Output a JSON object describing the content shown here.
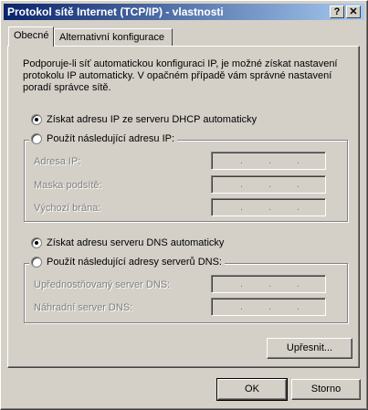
{
  "window": {
    "title": "Protokol sítě Internet (TCP/IP) - vlastnosti",
    "help_glyph": "?",
    "close_glyph": "✕"
  },
  "tabs": [
    {
      "label": "Obecné",
      "active": true
    },
    {
      "label": "Alternativní konfigurace",
      "active": false
    }
  ],
  "general": {
    "description": "Podporuje-li síť automatickou konfiguraci IP, je možné získat nastavení protokolu IP automaticky. V opačném případě vám správné nastavení poradí správce sítě.",
    "ip_auto_label": "Získat adresu IP ze serveru DHCP automaticky",
    "ip_auto_selected": true,
    "ip_manual_label": "Použít následující adresu IP:",
    "ip_manual_selected": false,
    "ip_address_label": "Adresa IP:",
    "subnet_mask_label": "Maska podsítě:",
    "gateway_label": "Výchozí brána:",
    "dns_auto_label": "Získat adresu serveru DNS automaticky",
    "dns_auto_selected": true,
    "dns_manual_label": "Použít následující adresy serverů DNS:",
    "dns_manual_selected": false,
    "preferred_dns_label": "Upřednostňovaný server DNS:",
    "alternate_dns_label": "Náhradní server DNS:",
    "ip_separator": ".",
    "advanced_button": "Upřesnit..."
  },
  "footer": {
    "ok_button": "OK",
    "cancel_button": "Storno"
  },
  "colors": {
    "titlebar_start": "#0a246a",
    "titlebar_end": "#a6caf0",
    "face": "#d4d0c8",
    "disabled_text": "#808080"
  }
}
